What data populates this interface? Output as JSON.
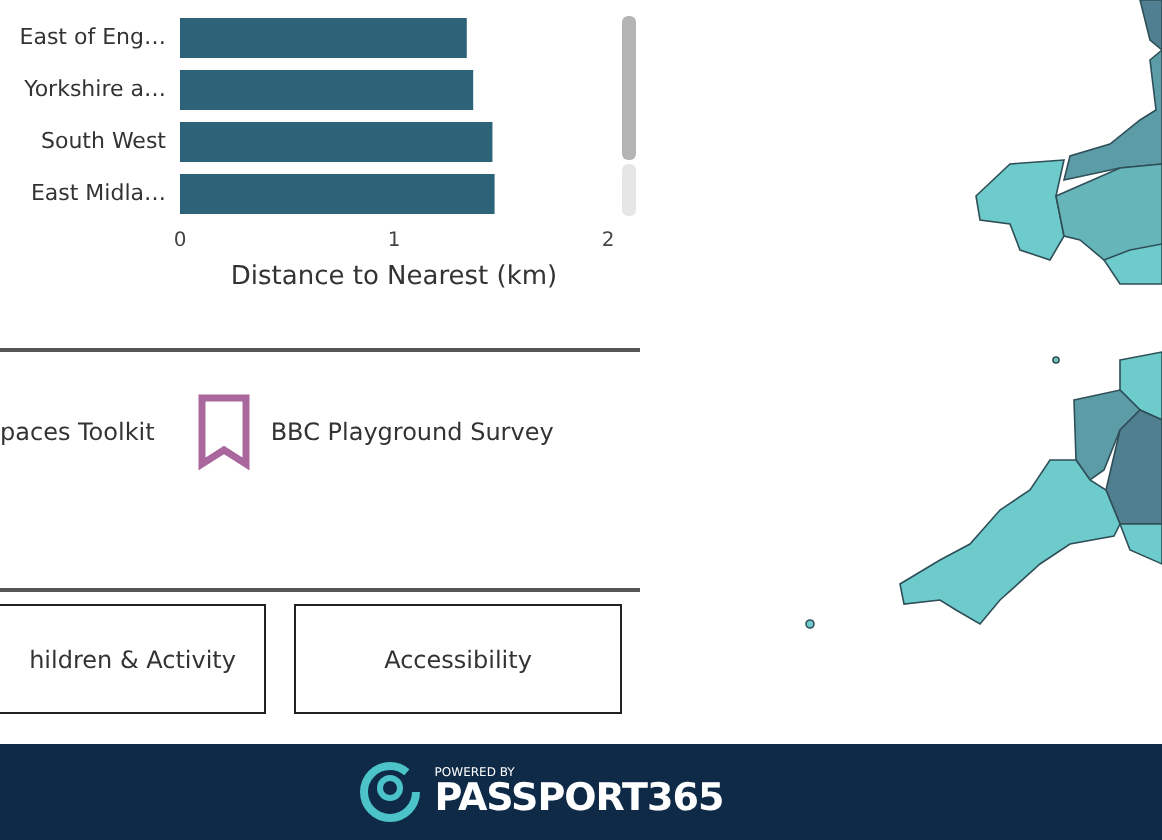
{
  "chart_data": {
    "type": "bar",
    "orientation": "horizontal",
    "xlabel": "Distance to Nearest (km)",
    "categories": [
      "East of Eng…",
      "Yorkshire a…",
      "South West",
      "East Midla…"
    ],
    "series": [
      {
        "color": "#2c6378",
        "values": [
          1.34,
          1.37,
          1.46,
          1.47
        ]
      }
    ],
    "xlim": [
      0,
      2
    ],
    "xticks": [
      0,
      1,
      2
    ]
  },
  "links": [
    {
      "label": "paces Toolkit"
    },
    {
      "label": "BBC Playground Survey"
    }
  ],
  "buttons": [
    {
      "label": "hildren & Activity"
    },
    {
      "label": "Accessibility"
    }
  ],
  "footer": {
    "tagline": "POWERED BY",
    "brand": "PASSPORT365"
  }
}
